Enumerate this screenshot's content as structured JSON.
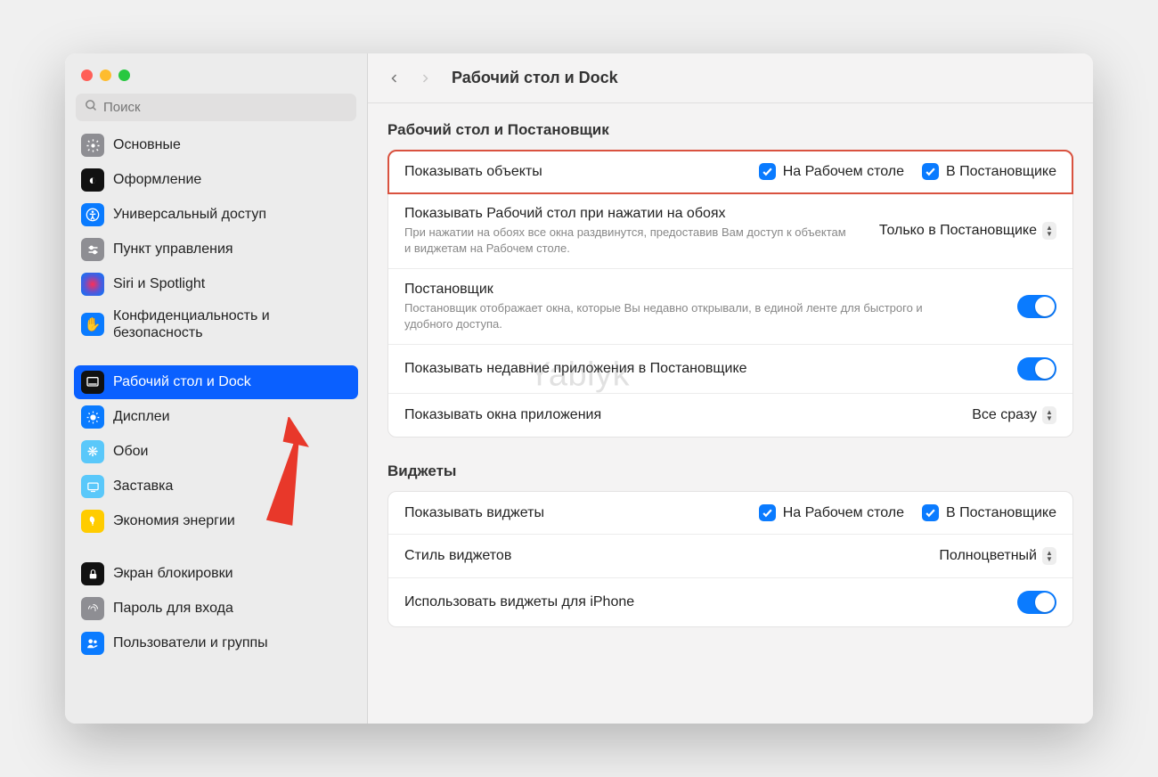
{
  "search": {
    "placeholder": "Поиск"
  },
  "sidebar": {
    "items": [
      {
        "label": "Основные",
        "icon": "gear",
        "color": "#8e8e93"
      },
      {
        "label": "Оформление",
        "icon": "appearance",
        "color": "#111"
      },
      {
        "label": "Универсальный доступ",
        "icon": "accessibility",
        "color": "#0a7bff"
      },
      {
        "label": "Пункт управления",
        "icon": "control-center",
        "color": "#8e8e93"
      },
      {
        "label": "Siri и Spotlight",
        "icon": "siri",
        "color": "#222"
      },
      {
        "label": "Конфиденциальность и безопасность",
        "icon": "hand",
        "color": "#0a7bff"
      },
      {
        "label": "Рабочий стол и Dock",
        "icon": "dock",
        "color": "#111",
        "selected": true
      },
      {
        "label": "Дисплеи",
        "icon": "displays",
        "color": "#0a7bff"
      },
      {
        "label": "Обои",
        "icon": "wallpaper",
        "color": "#5ac8fa"
      },
      {
        "label": "Заставка",
        "icon": "screensaver",
        "color": "#5ac8fa"
      },
      {
        "label": "Экономия энергии",
        "icon": "energy",
        "color": "#ffcc00"
      },
      {
        "label": "Экран блокировки",
        "icon": "lock",
        "color": "#111"
      },
      {
        "label": "Пароль для входа",
        "icon": "password",
        "color": "#8e8e93"
      },
      {
        "label": "Пользователи и группы",
        "icon": "users",
        "color": "#0a7bff"
      }
    ]
  },
  "header": {
    "title": "Рабочий стол и Dock"
  },
  "sections": {
    "desktop": {
      "title": "Рабочий стол и Постановщик",
      "show_items_label": "Показывать объекты",
      "cb_desktop_label": "На Рабочем столе",
      "cb_stage_label": "В Постановщике",
      "click_wallpaper": {
        "label": "Показывать Рабочий стол при нажатии на обоях",
        "desc": "При нажатии на обоях все окна раздвинутся, предоставив Вам доступ к объектам и виджетам на Рабочем столе.",
        "value": "Только в Постановщике"
      },
      "stage_manager": {
        "label": "Постановщик",
        "desc": "Постановщик отображает окна, которые Вы недавно открывали, в единой ленте для быстрого и удобного доступа."
      },
      "recent_apps_label": "Показывать недавние приложения в Постановщике",
      "show_windows": {
        "label": "Показывать окна приложения",
        "value": "Все сразу"
      }
    },
    "widgets": {
      "title": "Виджеты",
      "show_widgets_label": "Показывать виджеты",
      "cb_desktop_label": "На Рабочем столе",
      "cb_stage_label": "В Постановщике",
      "style": {
        "label": "Стиль виджетов",
        "value": "Полноцветный"
      },
      "iphone_label": "Использовать виджеты для iPhone"
    }
  },
  "watermark": "Yablyk"
}
